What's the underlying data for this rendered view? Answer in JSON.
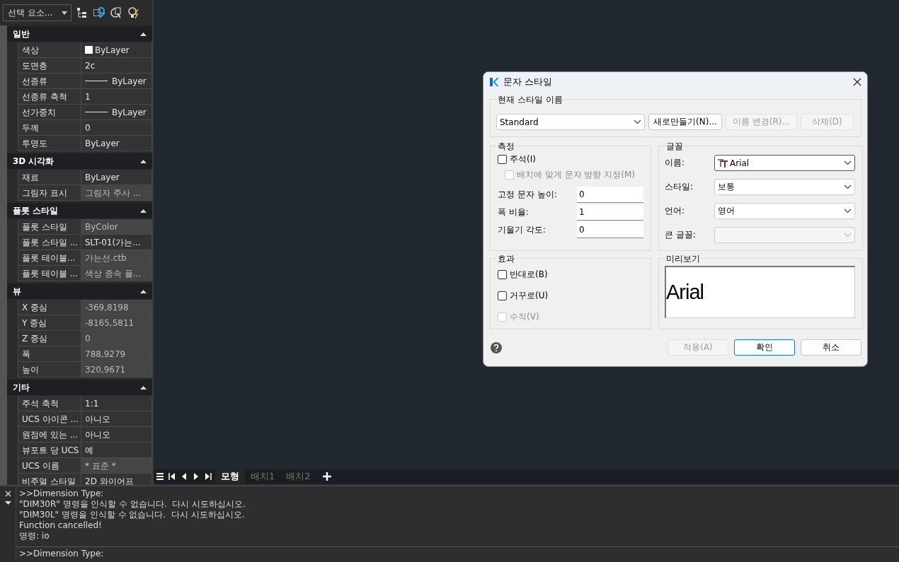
{
  "properties": {
    "selector": "선택 요소...",
    "sections": [
      {
        "title": "일반",
        "expanded": true,
        "rows": [
          {
            "name": "색상",
            "value": "ByLayer",
            "kind": "color",
            "readonly": false
          },
          {
            "name": "도면층",
            "value": "2c",
            "kind": "text",
            "readonly": false
          },
          {
            "name": "선종류",
            "value": "ByLayer",
            "kind": "line",
            "readonly": false
          },
          {
            "name": "선종류 축척",
            "value": "1",
            "kind": "text",
            "readonly": false
          },
          {
            "name": "선가중치",
            "value": "ByLayer",
            "kind": "line",
            "readonly": false
          },
          {
            "name": "두께",
            "value": "0",
            "kind": "text",
            "readonly": false
          },
          {
            "name": "투명도",
            "value": "ByLayer",
            "kind": "text",
            "readonly": false
          }
        ]
      },
      {
        "title": "3D 시각화",
        "expanded": true,
        "rows": [
          {
            "name": "재료",
            "value": "ByLayer",
            "kind": "text",
            "readonly": false
          },
          {
            "name": "그림자 표시",
            "value": "그림자 주사 ...",
            "kind": "text",
            "readonly": true
          }
        ]
      },
      {
        "title": "플롯 스타일",
        "expanded": true,
        "rows": [
          {
            "name": "플롯 스타일",
            "value": "ByColor",
            "kind": "text",
            "readonly": true
          },
          {
            "name": "플롯 스타일 ...",
            "value": "SLT-01(가는...",
            "kind": "text",
            "readonly": false
          },
          {
            "name": "플롯 테이블...",
            "value": "가는선.ctb",
            "kind": "text",
            "readonly": true
          },
          {
            "name": "플롯 테이블 ...",
            "value": "색상 종속 플...",
            "kind": "text",
            "readonly": true
          }
        ]
      },
      {
        "title": "뷰",
        "expanded": true,
        "rows": [
          {
            "name": "X 중심",
            "value": "-369,8198",
            "kind": "text",
            "readonly": true
          },
          {
            "name": "Y 중심",
            "value": "-8165,5811",
            "kind": "text",
            "readonly": true
          },
          {
            "name": "Z 중심",
            "value": "0",
            "kind": "text",
            "readonly": true
          },
          {
            "name": "폭",
            "value": "788,9279",
            "kind": "text",
            "readonly": true
          },
          {
            "name": "높이",
            "value": "320,9671",
            "kind": "text",
            "readonly": true
          }
        ]
      },
      {
        "title": "기타",
        "expanded": true,
        "rows": [
          {
            "name": "주석 축척",
            "value": "1:1",
            "kind": "text",
            "readonly": false
          },
          {
            "name": "UCS 아이콘 ...",
            "value": "아니오",
            "kind": "text",
            "readonly": false
          },
          {
            "name": "원점에 있는 ...",
            "value": "아니오",
            "kind": "text",
            "readonly": false
          },
          {
            "name": "뷰포트 당 UCS",
            "value": "예",
            "kind": "text",
            "readonly": false
          },
          {
            "name": "UCS 이름",
            "value": "* 표준 *",
            "kind": "text",
            "readonly": true
          },
          {
            "name": "비주얼 스타일",
            "value": "2D 와이어프",
            "kind": "text",
            "readonly": false
          }
        ]
      }
    ]
  },
  "layout_tabs": [
    {
      "label": "모형",
      "selected": true
    },
    {
      "label": "배치1",
      "selected": false
    },
    {
      "label": "배치2",
      "selected": false
    }
  ],
  "command_line": {
    "history": [
      ">>Dimension Type:",
      "\"DIM30R\" 명령을 인식할 수 없습니다.  다시 시도하십시오.",
      "\"DIM30L\" 명령을 인식할 수 없습니다.  다시 시도하십시오.",
      "Function cancelled!",
      "명령: io"
    ],
    "input": ">>Dimension Type:"
  },
  "dialog": {
    "title": "문자 스타일",
    "current_style": {
      "legend": "현재 스타일 이름",
      "value": "Standard",
      "buttons": [
        {
          "label": "새로만들기(N)...",
          "disabled": false
        },
        {
          "label": "이름 변경(R)...",
          "disabled": true
        },
        {
          "label": "삭제(D)",
          "disabled": true
        }
      ]
    },
    "size": {
      "legend": "측정",
      "checkboxes": [
        {
          "label": "주석(I)",
          "checked": false,
          "disabled": false,
          "children": [
            {
              "label": "배치에 맞게 문자 방향 지정(M)",
              "checked": false,
              "disabled": true
            }
          ]
        }
      ],
      "fields": [
        {
          "label": "고정 문자 높이:",
          "value": "0"
        },
        {
          "label": "폭 비율:",
          "value": "1"
        },
        {
          "label": "기울기 각도:",
          "value": "0"
        }
      ]
    },
    "font": {
      "legend": "글꼴",
      "fields": [
        {
          "label": "이름:",
          "value": "Arial",
          "kind": "font",
          "disabled": false
        },
        {
          "label": "스타일:",
          "value": "보통",
          "kind": "plain",
          "disabled": false
        },
        {
          "label": "언어:",
          "value": "영어",
          "kind": "plain",
          "disabled": false
        },
        {
          "label": "큰 글꼴:",
          "kind": "plain",
          "disabled": true
        }
      ]
    },
    "effects": {
      "legend": "효과",
      "checkboxes": [
        {
          "label": "반대로(B)",
          "checked": false,
          "disabled": false
        },
        {
          "label": "거꾸로(U)",
          "checked": false,
          "disabled": false
        },
        {
          "label": "수직(V)",
          "checked": false,
          "disabled": true
        }
      ]
    },
    "preview": {
      "legend": "미리보기",
      "sample": "Arial"
    },
    "buttons": [
      {
        "label": "적용(A)",
        "disabled": true,
        "default": false
      },
      {
        "label": "확인",
        "disabled": false,
        "default": true
      },
      {
        "label": "취소",
        "disabled": false,
        "default": false
      }
    ]
  }
}
